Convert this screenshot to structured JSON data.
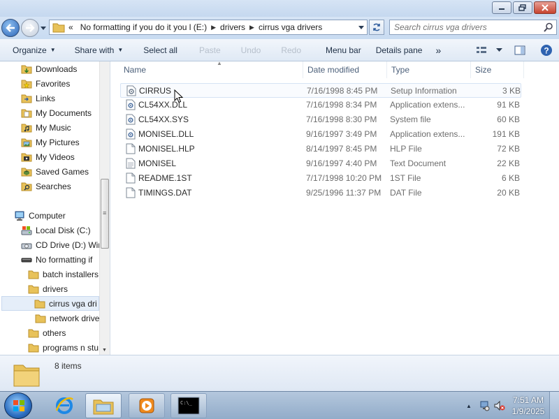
{
  "window": {
    "controls": [
      "minimize-icon",
      "maximize-icon",
      "close-icon"
    ]
  },
  "address": {
    "overflow": "«",
    "crumbs": [
      "No formatting if you do it you l (E:)",
      "drivers",
      "cirrus vga drivers"
    ],
    "search_placeholder": "Search cirrus vga drivers"
  },
  "commands": {
    "organize": "Organize",
    "share_with": "Share with",
    "select_all": "Select all",
    "paste": "Paste",
    "undo": "Undo",
    "redo": "Redo",
    "menu_bar": "Menu bar",
    "details_pane": "Details pane",
    "more": "»"
  },
  "nav": {
    "items": [
      {
        "label": "Downloads",
        "icon": "downloads-folder-icon"
      },
      {
        "label": "Favorites",
        "icon": "favorites-folder-icon"
      },
      {
        "label": "Links",
        "icon": "links-folder-icon"
      },
      {
        "label": "My Documents",
        "icon": "documents-folder-icon"
      },
      {
        "label": "My Music",
        "icon": "music-folder-icon"
      },
      {
        "label": "My Pictures",
        "icon": "pictures-folder-icon"
      },
      {
        "label": "My Videos",
        "icon": "videos-folder-icon"
      },
      {
        "label": "Saved Games",
        "icon": "games-folder-icon"
      },
      {
        "label": "Searches",
        "icon": "searches-folder-icon"
      },
      {
        "label": "Computer",
        "icon": "computer-icon"
      },
      {
        "label": "Local Disk (C:)",
        "icon": "disk-icon"
      },
      {
        "label": "CD Drive (D:) Wir",
        "icon": "cd-drive-icon"
      },
      {
        "label": "No formatting if",
        "icon": "usb-drive-icon"
      },
      {
        "label": "batch installers",
        "icon": "folder-icon"
      },
      {
        "label": "drivers",
        "icon": "folder-icon"
      },
      {
        "label": "cirrus vga dri",
        "icon": "folder-icon"
      },
      {
        "label": "network drive",
        "icon": "folder-icon"
      },
      {
        "label": "others",
        "icon": "folder-icon"
      },
      {
        "label": "programs n stu",
        "icon": "folder-icon"
      }
    ],
    "scroll_grip": "≡"
  },
  "columns": {
    "name": "Name",
    "date": "Date modified",
    "type": "Type",
    "size": "Size"
  },
  "files": [
    {
      "name": "CIRRUS",
      "date": "7/16/1998 8:45 PM",
      "type": "Setup Information",
      "size": "3 KB",
      "icon": "setup-file-icon"
    },
    {
      "name": "CL54XX.DLL",
      "date": "7/16/1998 8:34 PM",
      "type": "Application extens...",
      "size": "91 KB",
      "icon": "dll-file-icon"
    },
    {
      "name": "CL54XX.SYS",
      "date": "7/16/1998 8:30 PM",
      "type": "System file",
      "size": "60 KB",
      "icon": "system-file-icon"
    },
    {
      "name": "MONISEL.DLL",
      "date": "9/16/1997 3:49 PM",
      "type": "Application extens...",
      "size": "191 KB",
      "icon": "dll-file-icon"
    },
    {
      "name": "MONISEL.HLP",
      "date": "8/14/1997 8:45 PM",
      "type": "HLP File",
      "size": "72 KB",
      "icon": "file-icon"
    },
    {
      "name": "MONISEL",
      "date": "9/16/1997 4:40 PM",
      "type": "Text Document",
      "size": "22 KB",
      "icon": "text-file-icon"
    },
    {
      "name": "README.1ST",
      "date": "7/17/1998 10:20 PM",
      "type": "1ST File",
      "size": "6 KB",
      "icon": "file-icon"
    },
    {
      "name": "TIMINGS.DAT",
      "date": "9/25/1996 11:37 PM",
      "type": "DAT File",
      "size": "20 KB",
      "icon": "file-icon"
    }
  ],
  "details": {
    "item_count": "8 items"
  },
  "taskbar": {
    "apps": [
      "internet-explorer-icon",
      "windows-explorer-icon",
      "media-player-icon",
      "command-prompt-icon"
    ],
    "cmd_label": "C:\\_",
    "tray_up": "▲",
    "time": "7:51 AM",
    "date": "1/9/2025"
  },
  "colors": {
    "accent": "#2a64b8",
    "selected_bg": "#e5eef9",
    "folder": "#e8c25a"
  }
}
